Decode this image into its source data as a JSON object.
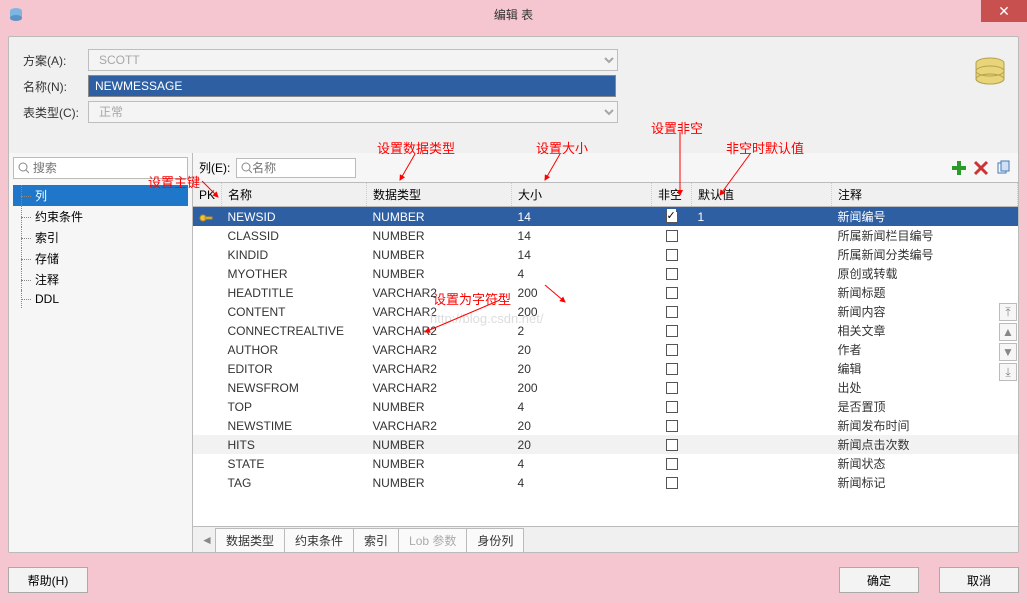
{
  "window": {
    "title": "编辑 表"
  },
  "form": {
    "schema_lbl": "方案(A):",
    "schema_val": "SCOTT",
    "name_lbl": "名称(N):",
    "name_val": "NEWMESSAGE",
    "type_lbl": "表类型(C):",
    "type_val": "正常"
  },
  "sidebar": {
    "search_ph": "搜索",
    "items": [
      "列",
      "约束条件",
      "索引",
      "存储",
      "注释",
      "DDL"
    ]
  },
  "toolbar": {
    "col_lbl": "列(E):",
    "name_ph": "名称"
  },
  "headers": {
    "pk": "PK",
    "name": "名称",
    "type": "数据类型",
    "size": "大小",
    "null": "非空",
    "def": "默认值",
    "comment": "注释"
  },
  "rows": [
    {
      "name": "NEWSID",
      "type": "NUMBER",
      "size": "14",
      "null": true,
      "def": "1",
      "comment": "新闻编号",
      "sel": true
    },
    {
      "name": "CLASSID",
      "type": "NUMBER",
      "size": "14",
      "null": false,
      "def": "",
      "comment": "所属新闻栏目编号"
    },
    {
      "name": "KINDID",
      "type": "NUMBER",
      "size": "14",
      "null": false,
      "def": "",
      "comment": "所属新闻分类编号"
    },
    {
      "name": "MYOTHER",
      "type": "NUMBER",
      "size": "4",
      "null": false,
      "def": "",
      "comment": "原创或转载"
    },
    {
      "name": "HEADTITLE",
      "type": "VARCHAR2",
      "size": "200",
      "null": false,
      "def": "",
      "comment": "新闻标题"
    },
    {
      "name": "CONTENT",
      "type": "VARCHAR2",
      "size": "200",
      "null": false,
      "def": "",
      "comment": "新闻内容"
    },
    {
      "name": "CONNECTREALTIVE",
      "type": "VARCHAR2",
      "size": "2",
      "null": false,
      "def": "",
      "comment": "相关文章"
    },
    {
      "name": "AUTHOR",
      "type": "VARCHAR2",
      "size": "20",
      "null": false,
      "def": "",
      "comment": "作者"
    },
    {
      "name": "EDITOR",
      "type": "VARCHAR2",
      "size": "20",
      "null": false,
      "def": "",
      "comment": "编辑"
    },
    {
      "name": "NEWSFROM",
      "type": "VARCHAR2",
      "size": "200",
      "null": false,
      "def": "",
      "comment": "出处"
    },
    {
      "name": "TOP",
      "type": "NUMBER",
      "size": "4",
      "null": false,
      "def": "",
      "comment": "是否置顶"
    },
    {
      "name": "NEWSTIME",
      "type": "VARCHAR2",
      "size": "20",
      "null": false,
      "def": "",
      "comment": "新闻发布时间"
    },
    {
      "name": "HITS",
      "type": "NUMBER",
      "size": "20",
      "null": false,
      "def": "",
      "comment": "新闻点击次数",
      "alt": true
    },
    {
      "name": "STATE",
      "type": "NUMBER",
      "size": "4",
      "null": false,
      "def": "",
      "comment": "新闻状态"
    },
    {
      "name": "TAG",
      "type": "NUMBER",
      "size": "4",
      "null": false,
      "def": "",
      "comment": "新闻标记"
    }
  ],
  "tabs": {
    "t1": "数据类型",
    "t2": "约束条件",
    "t3": "索引",
    "t4": "Lob 参数",
    "t5": "身份列"
  },
  "buttons": {
    "help": "帮助(H)",
    "ok": "确定",
    "cancel": "取消"
  },
  "ann": {
    "pk": "设置主键",
    "type": "设置数据类型",
    "size": "设置大小",
    "null": "设置非空",
    "def": "非空时默认值",
    "vc": "设置为字符型"
  },
  "watermark": "http://blog.csdn.net/"
}
